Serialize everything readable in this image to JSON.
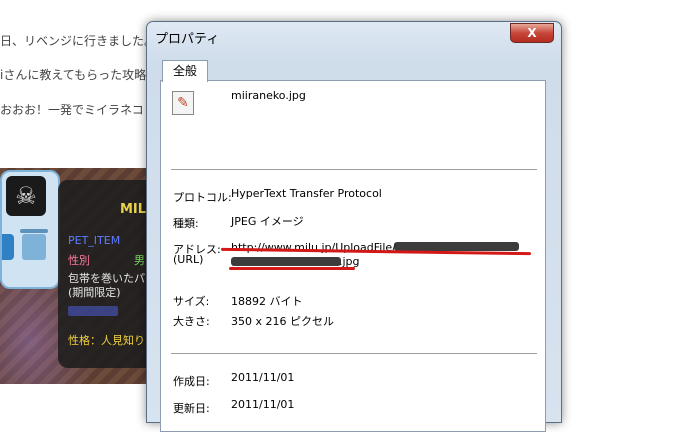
{
  "background_page": {
    "lines": [
      "日、リベンジに行きました。",
      "iさんに教えてもらった攻略",
      "おおお！一発でミイラネコ"
    ],
    "pet_panel": {
      "name_partial": "MIL",
      "item_label": "PET_ITEM",
      "gender_label": "性別",
      "gender_value": "男",
      "item_desc_1": "包帯を巻いたパ",
      "item_desc_2": "(期間限定)",
      "blurred_text": "",
      "personality": "性格：人見知り"
    }
  },
  "dialog": {
    "title": "プロパティ",
    "close_label": "X",
    "tab_label": "全般",
    "file_name": "miiraneko.jpg",
    "fields": {
      "protocol_label": "プロトコル:",
      "protocol_value": "HyperText Transfer Protocol",
      "type_label": "種類:",
      "type_value": "JPEG イメージ",
      "address_label_1": "アドレス:",
      "address_label_2": "(URL)",
      "address_value_1": "http://www.milu.jp/UploadFile/",
      "address_value_2": ".jpg",
      "size_label": "サイズ:",
      "size_value": "18892 バイト",
      "dimensions_label": "大きさ:",
      "dimensions_value": "350 x 216 ピクセル",
      "created_label": "作成日:",
      "created_value": "2011/11/01",
      "modified_label": "更新日:",
      "modified_value": "2011/11/01"
    }
  },
  "colors": {
    "annotation_red": "#d41818",
    "close_red": "#c7473a"
  }
}
